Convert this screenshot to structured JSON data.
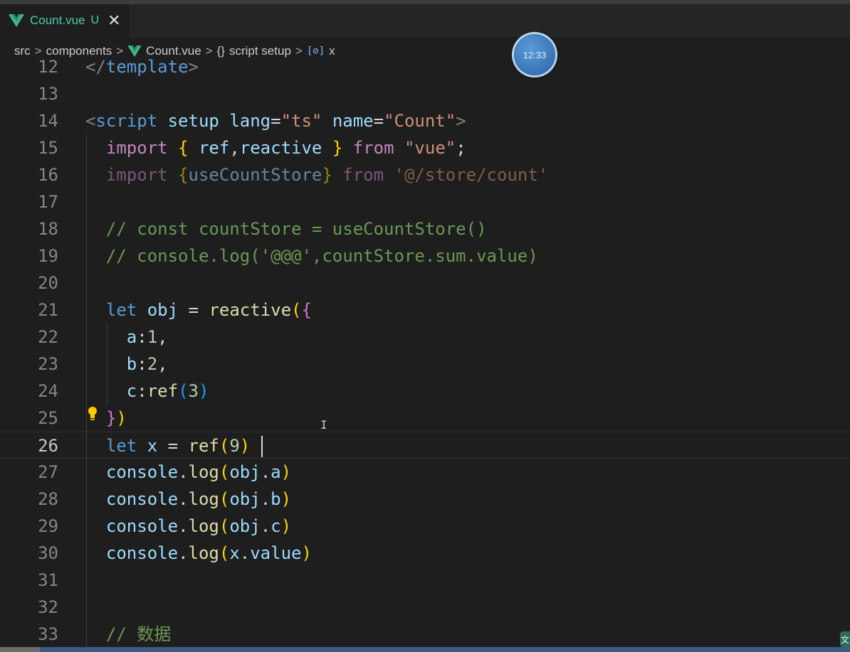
{
  "tab": {
    "filename": "Count.vue",
    "status": "U",
    "close": "✕"
  },
  "breadcrumb": {
    "items": [
      "src",
      "components",
      "Count.vue",
      "script setup",
      "x"
    ],
    "separator": ">",
    "braces": "{}",
    "var_icon": "[⊘]"
  },
  "clock": {
    "time": "12:33"
  },
  "cursor": {
    "ibeam": "I"
  },
  "corner": {
    "glyph": "文"
  },
  "colors": {
    "background": "#1e1e1e",
    "tab_active": "#4ec9b0",
    "comment": "#6a9955",
    "keyword": "#c586c0",
    "string": "#ce9178",
    "function": "#dcdcaa",
    "variable": "#9cdcfe"
  },
  "lines": [
    {
      "n": "12",
      "t": [
        [
          "</",
          "t-punct"
        ],
        [
          "template",
          "t-tag"
        ],
        [
          ">",
          "t-punct"
        ]
      ]
    },
    {
      "n": "13",
      "t": []
    },
    {
      "n": "14",
      "t": [
        [
          "<",
          "t-punct"
        ],
        [
          "script",
          "t-tag"
        ],
        [
          " ",
          ""
        ],
        [
          "setup",
          "t-attr"
        ],
        [
          " ",
          ""
        ],
        [
          "lang",
          "t-attr"
        ],
        [
          "=",
          ""
        ],
        [
          "\"ts\"",
          "t-str"
        ],
        [
          " ",
          ""
        ],
        [
          "name",
          "t-attr"
        ],
        [
          "=",
          ""
        ],
        [
          "\"Count\"",
          "t-str"
        ],
        [
          ">",
          "t-punct"
        ]
      ]
    },
    {
      "n": "15",
      "t": [
        [
          "  ",
          ""
        ],
        [
          "import",
          "t-kw"
        ],
        [
          " ",
          ""
        ],
        [
          "{",
          "t-b1"
        ],
        [
          " ",
          ""
        ],
        [
          "ref",
          "t-var"
        ],
        [
          ",",
          ""
        ],
        [
          "reactive",
          "t-var"
        ],
        [
          " ",
          ""
        ],
        [
          "}",
          "t-b1"
        ],
        [
          " ",
          ""
        ],
        [
          "from",
          "t-kw"
        ],
        [
          " ",
          ""
        ],
        [
          "\"vue\"",
          "t-str"
        ],
        [
          ";",
          ""
        ]
      ]
    },
    {
      "n": "16",
      "t": [
        [
          "  ",
          ""
        ],
        [
          "import",
          "t-kw t-dim"
        ],
        [
          " ",
          ""
        ],
        [
          "{",
          "t-b1 t-dim"
        ],
        [
          "useCountStore",
          "t-var t-dim"
        ],
        [
          "}",
          "t-b1 t-dim"
        ],
        [
          " ",
          ""
        ],
        [
          "from",
          "t-kw t-dim"
        ],
        [
          " ",
          ""
        ],
        [
          "'@/store/count'",
          "t-str t-dim"
        ]
      ]
    },
    {
      "n": "17",
      "t": []
    },
    {
      "n": "18",
      "t": [
        [
          "  ",
          ""
        ],
        [
          "// const countStore = useCountStore()",
          "t-com"
        ]
      ]
    },
    {
      "n": "19",
      "t": [
        [
          "  ",
          ""
        ],
        [
          "// console.log('@@@',countStore.sum.value)",
          "t-com"
        ]
      ]
    },
    {
      "n": "20",
      "t": []
    },
    {
      "n": "21",
      "t": [
        [
          "  ",
          ""
        ],
        [
          "let",
          "t-kw2"
        ],
        [
          " ",
          ""
        ],
        [
          "obj",
          "t-var"
        ],
        [
          " = ",
          ""
        ],
        [
          "reactive",
          "t-fn"
        ],
        [
          "(",
          "t-b1"
        ],
        [
          "{",
          "t-b2"
        ]
      ]
    },
    {
      "n": "22",
      "t": [
        [
          "    ",
          ""
        ],
        [
          "a",
          "t-var"
        ],
        [
          ":",
          ""
        ],
        [
          "1",
          "t-num"
        ],
        [
          ",",
          ""
        ]
      ]
    },
    {
      "n": "23",
      "t": [
        [
          "    ",
          ""
        ],
        [
          "b",
          "t-var"
        ],
        [
          ":",
          ""
        ],
        [
          "2",
          "t-num"
        ],
        [
          ",",
          ""
        ]
      ]
    },
    {
      "n": "24",
      "t": [
        [
          "    ",
          ""
        ],
        [
          "c",
          "t-var"
        ],
        [
          ":",
          ""
        ],
        [
          "ref",
          "t-fn"
        ],
        [
          "(",
          "t-b3"
        ],
        [
          "3",
          "t-num"
        ],
        [
          ")",
          "t-b3"
        ]
      ]
    },
    {
      "n": "25",
      "t": [
        [
          "  ",
          ""
        ],
        [
          "}",
          "t-b2"
        ],
        [
          ")",
          "t-b1"
        ]
      ]
    },
    {
      "n": "26",
      "t": [
        [
          "  ",
          ""
        ],
        [
          "let",
          "t-kw2"
        ],
        [
          " ",
          ""
        ],
        [
          "x",
          "t-var"
        ],
        [
          " = ",
          ""
        ],
        [
          "ref",
          "t-fn"
        ],
        [
          "(",
          "t-b1"
        ],
        [
          "9",
          "t-num"
        ],
        [
          ")",
          "t-b1"
        ]
      ]
    },
    {
      "n": "27",
      "t": [
        [
          "  ",
          ""
        ],
        [
          "console",
          "t-var"
        ],
        [
          ".",
          ""
        ],
        [
          "log",
          "t-fn"
        ],
        [
          "(",
          "t-b1"
        ],
        [
          "obj",
          "t-var"
        ],
        [
          ".",
          ""
        ],
        [
          "a",
          "t-var"
        ],
        [
          ")",
          "t-b1"
        ]
      ]
    },
    {
      "n": "28",
      "t": [
        [
          "  ",
          ""
        ],
        [
          "console",
          "t-var"
        ],
        [
          ".",
          ""
        ],
        [
          "log",
          "t-fn"
        ],
        [
          "(",
          "t-b1"
        ],
        [
          "obj",
          "t-var"
        ],
        [
          ".",
          ""
        ],
        [
          "b",
          "t-var"
        ],
        [
          ")",
          "t-b1"
        ]
      ]
    },
    {
      "n": "29",
      "t": [
        [
          "  ",
          ""
        ],
        [
          "console",
          "t-var"
        ],
        [
          ".",
          ""
        ],
        [
          "log",
          "t-fn"
        ],
        [
          "(",
          "t-b1"
        ],
        [
          "obj",
          "t-var"
        ],
        [
          ".",
          ""
        ],
        [
          "c",
          "t-var"
        ],
        [
          ")",
          "t-b1"
        ]
      ]
    },
    {
      "n": "30",
      "t": [
        [
          "  ",
          ""
        ],
        [
          "console",
          "t-var"
        ],
        [
          ".",
          ""
        ],
        [
          "log",
          "t-fn"
        ],
        [
          "(",
          "t-b1"
        ],
        [
          "x",
          "t-var"
        ],
        [
          ".",
          ""
        ],
        [
          "value",
          "t-var"
        ],
        [
          ")",
          "t-b1"
        ]
      ]
    },
    {
      "n": "31",
      "t": []
    },
    {
      "n": "32",
      "t": []
    },
    {
      "n": "33",
      "t": [
        [
          "  ",
          ""
        ],
        [
          "// 数据",
          "t-com"
        ]
      ]
    }
  ],
  "active_line": "26"
}
